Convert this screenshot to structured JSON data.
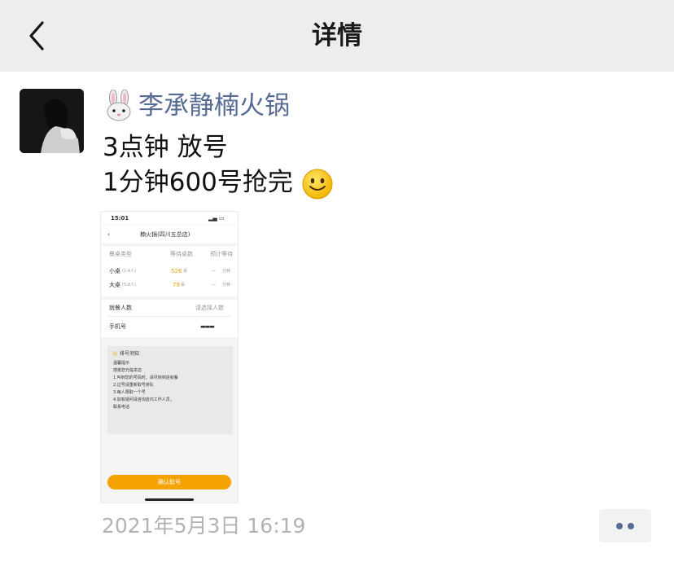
{
  "header": {
    "title": "详情"
  },
  "post": {
    "author": "李承静楠火锅",
    "lines": [
      "3点钟 放号",
      "1分钟600号抢完"
    ],
    "timestamp": "2021年5月3日 16:19",
    "image": {
      "status_time": "15:01",
      "title": "楠火锅(四川五总店)",
      "col_table": "餐桌类型",
      "col_waiting": "等待桌数",
      "col_time": "预计等待",
      "rows": [
        {
          "type": "小桌",
          "sub": "(1-4人)",
          "count": "526",
          "unit": "桌",
          "eta": "--",
          "eta_unit": "分钟"
        },
        {
          "type": "大桌",
          "sub": "(5-8人)",
          "count": "79",
          "unit": "桌",
          "eta": "--",
          "eta_unit": "分钟"
        }
      ],
      "diners_label": "就餐人数",
      "diners_value": "请选择人数",
      "phone_label": "手机号",
      "notice_title": "排号须知",
      "notice_lines": [
        "温馨提示",
        "感谢您光临本店",
        "1.叫到您的号码时，请尽快到店就餐",
        "2.过号请重新取号排队",
        "3.每人限取一个号",
        "4.如有疑问请咨询店内工作人员，",
        "  联系电话"
      ],
      "button": "确认取号"
    }
  },
  "colors": {
    "name": "#576b95",
    "timestamp": "#b2b2b2",
    "navbar": "#ededed",
    "accent_orange": "#f5a300"
  },
  "icons": {
    "back": "chevron-left-icon",
    "author_emoji": "rabbit-face-icon",
    "emoji": "smiling-face-icon",
    "more": "more-dots-icon"
  }
}
